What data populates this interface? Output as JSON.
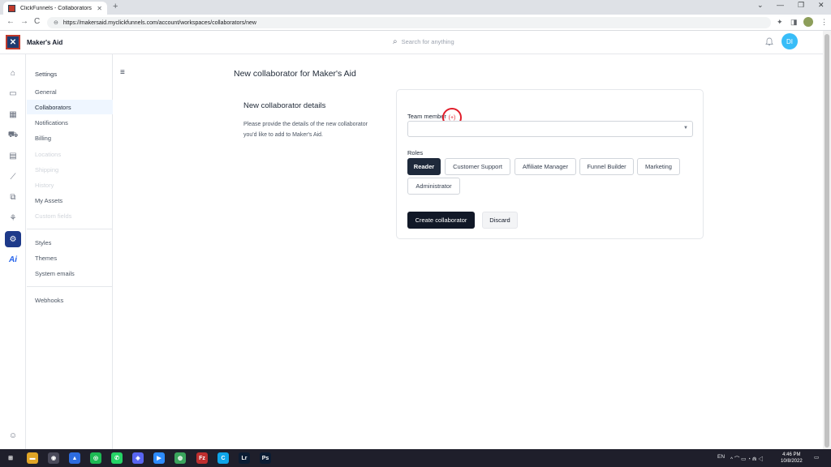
{
  "browser": {
    "tab_title": "ClickFunnels - Collaborators",
    "tab_close": "✕",
    "new_tab": "+",
    "url": "https://makersaid.myclickfunnels.com/account/workspaces/collaborators/new",
    "back": "←",
    "forward": "→",
    "reload": "C",
    "lock": "⊖",
    "extensions_icon": "✦",
    "sidepanel_icon": "◨",
    "menu_icon": "⋮",
    "minimize": "—",
    "restore": "❐",
    "close": "✕",
    "chevron": "⌄"
  },
  "header": {
    "workspace": "Maker's Aid",
    "search_placeholder": "Search for anything",
    "search_icon": "⌕",
    "bell_icon": "🔔",
    "avatar_initials": "DI"
  },
  "rail": {
    "items": [
      "⌂",
      "▭",
      "▦",
      "⛟",
      "▤",
      "⟋",
      "⧉",
      "⚘",
      "⚙"
    ],
    "ai": "Ai",
    "help": "☺"
  },
  "settings": {
    "heading": "Settings",
    "items": [
      {
        "label": "General",
        "state": "normal"
      },
      {
        "label": "Collaborators",
        "state": "active"
      },
      {
        "label": "Notifications",
        "state": "normal"
      },
      {
        "label": "Billing",
        "state": "normal"
      },
      {
        "label": "Locations",
        "state": "muted"
      },
      {
        "label": "Shipping",
        "state": "muted"
      },
      {
        "label": "History",
        "state": "muted"
      },
      {
        "label": "My Assets",
        "state": "normal"
      },
      {
        "label": "Custom fields",
        "state": "muted"
      }
    ],
    "group2": [
      "Styles",
      "Themes",
      "System emails"
    ],
    "group3": [
      "Webhooks"
    ]
  },
  "main": {
    "menu_icon": "≡",
    "page_title": "New collaborator for Maker's Aid",
    "section_title": "New collaborator details",
    "section_desc": "Please provide the details of the new collaborator you'd like to add to Maker's Aid.",
    "team_member_label": "Team member",
    "ring_label": "(+)",
    "select_caret": "▼",
    "roles_label": "Roles",
    "roles": [
      {
        "label": "Reader",
        "active": true
      },
      {
        "label": "Customer Support",
        "active": false
      },
      {
        "label": "Affiliate Manager",
        "active": false
      },
      {
        "label": "Funnel Builder",
        "active": false
      },
      {
        "label": "Marketing",
        "active": false
      },
      {
        "label": "Administrator",
        "active": false
      }
    ],
    "create_button": "Create collaborator",
    "discard_button": "Discard"
  },
  "taskbar": {
    "apps": [
      {
        "label": "⊞",
        "color": "#1f1f2b"
      },
      {
        "label": "▬",
        "color": "#e0a526"
      },
      {
        "label": "◉",
        "color": "#4a4a5a"
      },
      {
        "label": "▲",
        "color": "#2d6cdf"
      },
      {
        "label": "◎",
        "color": "#1db954"
      },
      {
        "label": "✆",
        "color": "#25d366"
      },
      {
        "label": "◈",
        "color": "#5865f2"
      },
      {
        "label": "▶",
        "color": "#2d8cff"
      },
      {
        "label": "◍",
        "color": "#3ba55d"
      },
      {
        "label": "Fz",
        "color": "#bf2e2e"
      },
      {
        "label": "C",
        "color": "#0ea5e9"
      },
      {
        "label": "Lr",
        "color": "#0b1c33"
      },
      {
        "label": "Ps",
        "color": "#0b1c33"
      }
    ],
    "lang": "EN",
    "tray_icons": "^ ⌒ ▭ ◔ ⋒ ◁",
    "time": "4:46 PM",
    "date": "10/8/2022",
    "notif": "▭"
  }
}
